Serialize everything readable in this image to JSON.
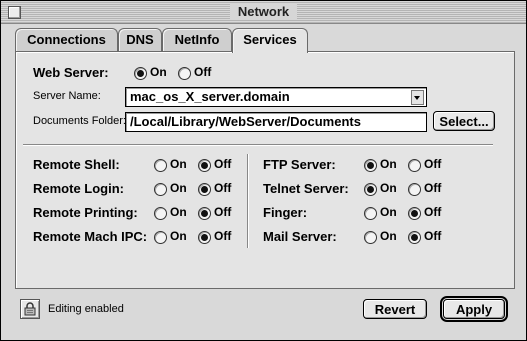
{
  "window": {
    "title": "Network"
  },
  "tabs": [
    {
      "label": "Connections",
      "active": false
    },
    {
      "label": "DNS",
      "active": false
    },
    {
      "label": "NetInfo",
      "active": false
    },
    {
      "label": "Services",
      "active": true
    }
  ],
  "web_server": {
    "label": "Web Server:",
    "on_label": "On",
    "off_label": "Off",
    "value": "On"
  },
  "server_name": {
    "label": "Server Name:",
    "value": "mac_os_X_server.domain"
  },
  "documents_folder": {
    "label": "Documents Folder:",
    "value": "/Local/Library/WebServer/Documents",
    "select_label": "Select..."
  },
  "services_left": [
    {
      "label": "Remote Shell:",
      "on": "On",
      "off": "Off",
      "value": "Off"
    },
    {
      "label": "Remote Login:",
      "on": "On",
      "off": "Off",
      "value": "Off"
    },
    {
      "label": "Remote Printing:",
      "on": "On",
      "off": "Off",
      "value": "Off"
    },
    {
      "label": "Remote Mach IPC:",
      "on": "On",
      "off": "Off",
      "value": "Off"
    }
  ],
  "services_right": [
    {
      "label": "FTP Server:",
      "on": "On",
      "off": "Off",
      "value": "On"
    },
    {
      "label": "Telnet Server:",
      "on": "On",
      "off": "Off",
      "value": "On"
    },
    {
      "label": "Finger:",
      "on": "On",
      "off": "Off",
      "value": "Off"
    },
    {
      "label": "Mail Server:",
      "on": "On",
      "off": "Off",
      "value": "Off"
    }
  ],
  "footer": {
    "lock_icon": "lock-icon",
    "status_text": "Editing enabled",
    "revert_label": "Revert",
    "apply_label": "Apply"
  }
}
